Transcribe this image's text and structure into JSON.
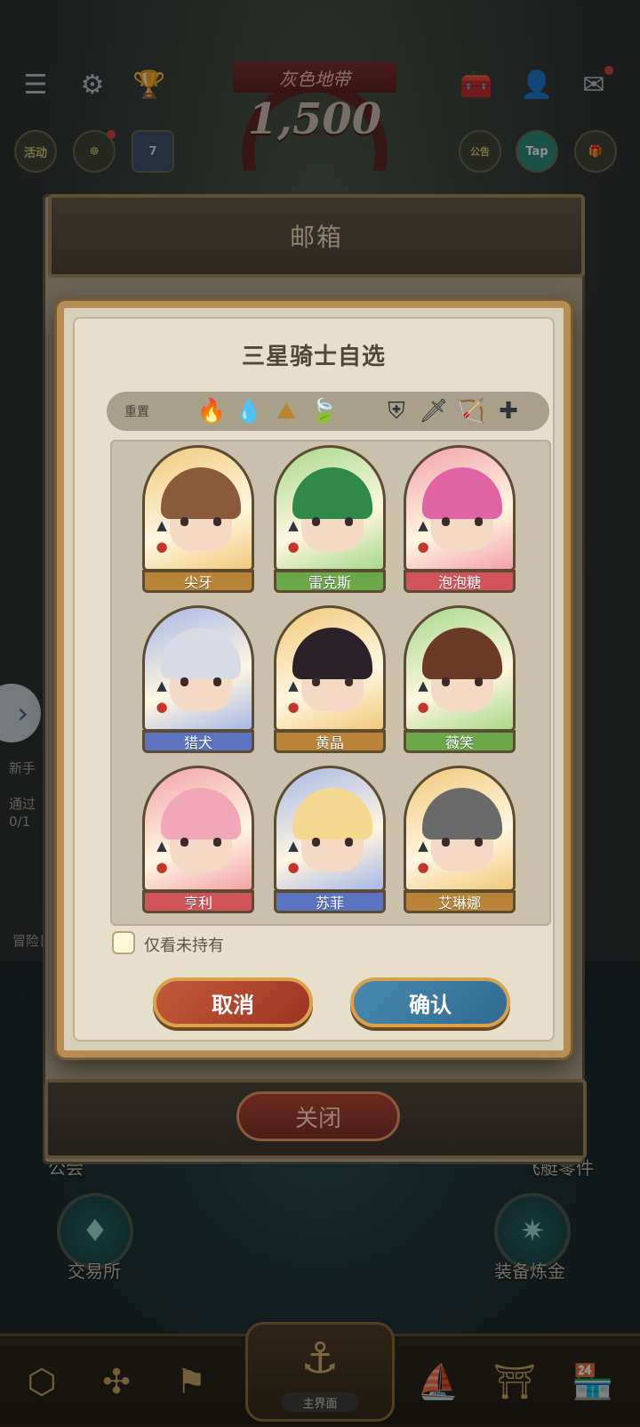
{
  "top_hud": {
    "rank_title": "灰色地带",
    "rank_score": "1,500",
    "icons": [
      "menu-icon",
      "gear-icon",
      "trophy-icon",
      "toolbox-icon",
      "friends-icon",
      "mail-icon"
    ],
    "event_label": "活动",
    "calendar_day": "7",
    "tap_label": "Tap",
    "notice_label": "公告"
  },
  "mailbox": {
    "title": "邮箱",
    "close_label": "关闭"
  },
  "dialog": {
    "title": "三星骑士自选",
    "reset_label": "重置",
    "filters": [
      {
        "name": "fire-element-icon",
        "glyph": "🔥",
        "color": "#c2362b"
      },
      {
        "name": "water-element-icon",
        "glyph": "💧",
        "color": "#3f72c5"
      },
      {
        "name": "earth-element-icon",
        "glyph": "⛰",
        "color": "#b8862e"
      },
      {
        "name": "wind-element-icon",
        "glyph": "🍃",
        "color": "#5a9a3a"
      },
      {
        "name": "shield-class-icon",
        "glyph": "⛨",
        "color": "#2d3440"
      },
      {
        "name": "sword-class-icon",
        "glyph": "🗡",
        "color": "#2d3440"
      },
      {
        "name": "bow-class-icon",
        "glyph": "🏹",
        "color": "#2d3440"
      },
      {
        "name": "cross-class-icon",
        "glyph": "✚",
        "color": "#2d3440"
      }
    ],
    "knights": [
      {
        "name": "尖牙",
        "bg": "#f0c97a",
        "label_color": "#b98338",
        "hair": "#8a5a3a"
      },
      {
        "name": "雷克斯",
        "bg": "#a6d98a",
        "label_color": "#6aa84a",
        "hair": "#2f8a4a"
      },
      {
        "name": "泡泡糖",
        "bg": "#f2a2a8",
        "label_color": "#d0545a",
        "hair": "#e064a4"
      },
      {
        "name": "猎犬",
        "bg": "#a8b8e6",
        "label_color": "#5a74c2",
        "hair": "#d8dbe4"
      },
      {
        "name": "黄晶",
        "bg": "#f0c97a",
        "label_color": "#b98338",
        "hair": "#2a2228"
      },
      {
        "name": "薇笑",
        "bg": "#a6d98a",
        "label_color": "#6aa84a",
        "hair": "#6a3a26"
      },
      {
        "name": "亨利",
        "bg": "#f2a2a8",
        "label_color": "#d0545a",
        "hair": "#f0a8b8"
      },
      {
        "name": "苏菲",
        "bg": "#a8b8e6",
        "label_color": "#5a74c2",
        "hair": "#f4d890"
      },
      {
        "name": "艾琳娜",
        "bg": "#f0c97a",
        "label_color": "#b98338",
        "hair": "#6a6a6a"
      }
    ],
    "only_unowned_label": "仅看未持有",
    "cancel_label": "取消",
    "confirm_label": "确认"
  },
  "side": {
    "newbie": "新手",
    "pass": "通过",
    "progress": "0/1",
    "adventure": "冒险日"
  },
  "hub": {
    "guild": "公会",
    "exchange": "交易所",
    "alchemy": "装备炼金",
    "parts": "飞艇零件"
  },
  "bottom_nav": {
    "main_label": "主界面"
  }
}
